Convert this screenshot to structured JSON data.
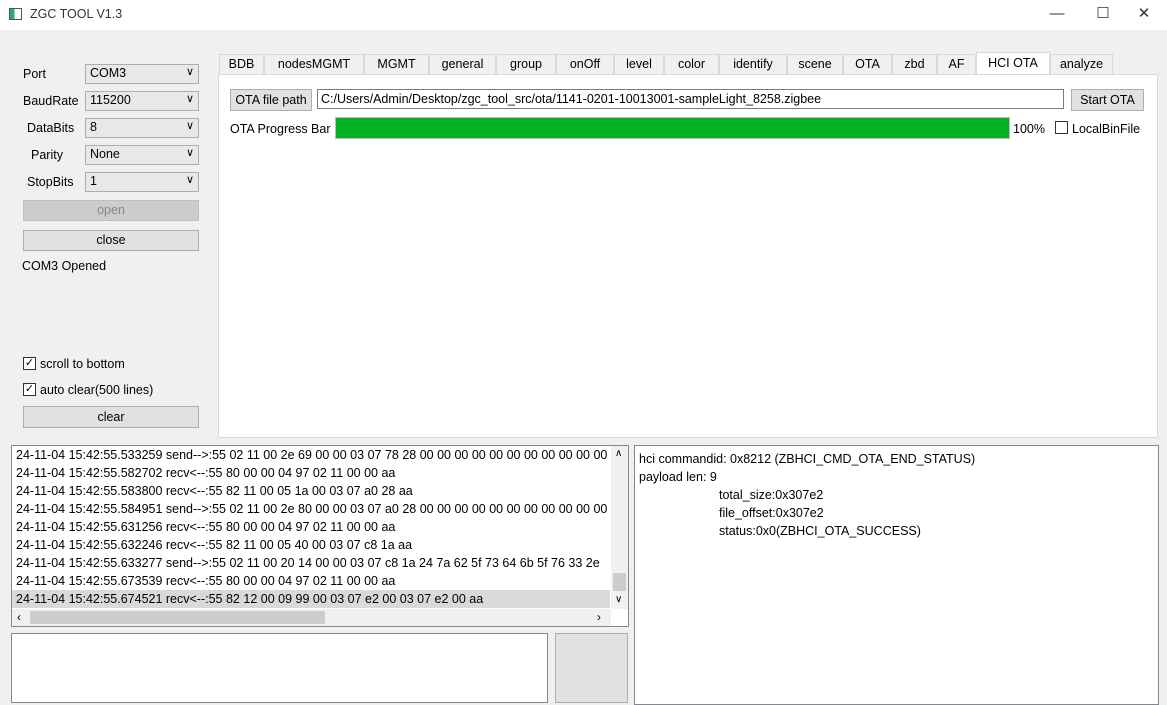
{
  "window": {
    "title": "ZGC TOOL V1.3",
    "minimize": "—",
    "maximize": "☐",
    "close": "✕"
  },
  "serial": {
    "port": {
      "label": "Port",
      "value": "COM3"
    },
    "baudrate": {
      "label": "BaudRate",
      "value": "115200"
    },
    "databits": {
      "label": "DataBits",
      "value": "8"
    },
    "parity": {
      "label": "Parity",
      "value": "None"
    },
    "stopbits": {
      "label": "StopBits",
      "value": "1"
    },
    "open_label": "open",
    "close_label": "close",
    "status": "COM3 Opened",
    "scroll_to_bottom": {
      "label": "scroll to bottom",
      "checked": true
    },
    "auto_clear": {
      "label": "auto clear(500 lines)",
      "checked": true
    },
    "clear_label": "clear"
  },
  "tabs": [
    {
      "label": "BDB"
    },
    {
      "label": "nodesMGMT"
    },
    {
      "label": "MGMT"
    },
    {
      "label": "general"
    },
    {
      "label": "group"
    },
    {
      "label": "onOff"
    },
    {
      "label": "level"
    },
    {
      "label": "color"
    },
    {
      "label": "identify"
    },
    {
      "label": "scene"
    },
    {
      "label": "OTA"
    },
    {
      "label": "zbd"
    },
    {
      "label": "AF"
    },
    {
      "label": "HCI OTA",
      "active": true
    },
    {
      "label": "analyze"
    }
  ],
  "hci_ota": {
    "file_path_button": "OTA file path",
    "file_path": "C:/Users/Admin/Desktop/zgc_tool_src/ota/1141-0201-10013001-sampleLight_8258.zigbee",
    "start_button": "Start OTA",
    "progress_label": "OTA Progress Bar",
    "progress_percent": 100,
    "progress_text": "100%",
    "progress_color": "#06b025",
    "local_bin_file": {
      "label": "LocalBinFile",
      "checked": false
    }
  },
  "log": {
    "lines": [
      "24-11-04 15:42:55.533259 send-->:55 02 11 00 2e 69 00 00 03 07 78 28 00 00 00 00 00 00 00 00 00 00 00 00 0",
      "24-11-04 15:42:55.582702 recv<--:55 80 00 00 04 97 02 11 00 00 aa",
      "24-11-04 15:42:55.583800 recv<--:55 82 11 00 05 1a 00 03 07 a0 28 aa",
      "24-11-04 15:42:55.584951 send-->:55 02 11 00 2e 80 00 00 03 07 a0 28 00 00 00 00 00 00 00 00 00 00 00 00 0",
      "24-11-04 15:42:55.631256 recv<--:55 80 00 00 04 97 02 11 00 00 aa",
      "24-11-04 15:42:55.632246 recv<--:55 82 11 00 05 40 00 03 07 c8 1a aa",
      "24-11-04 15:42:55.633277 send-->:55 02 11 00 20 14 00 00 03 07 c8 1a 24 7a 62 5f 73 64 6b 5f 76 33 2e",
      "24-11-04 15:42:55.673539 recv<--:55 80 00 00 04 97 02 11 00 00 aa",
      "24-11-04 15:42:55.674521 recv<--:55 82 12 00 09 99 00 03 07 e2 00 03 07 e2 00 aa"
    ],
    "selected_index": 8
  },
  "analyze": {
    "line1": "hci commandid: 0x8212 (ZBHCI_CMD_OTA_END_STATUS)",
    "line2": "payload len: 9",
    "line3": "total_size:0x307e2",
    "line4": "file_offset:0x307e2",
    "line5": "status:0x0(ZBHCI_OTA_SUCCESS)"
  }
}
